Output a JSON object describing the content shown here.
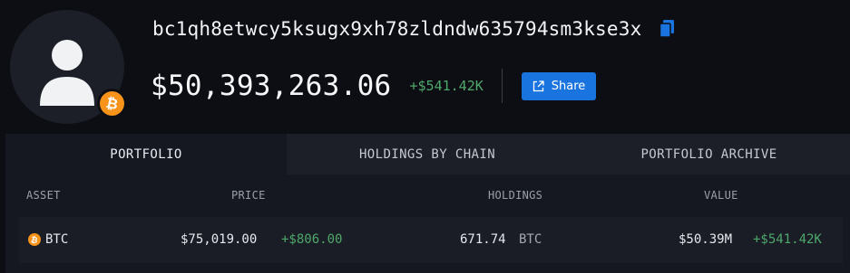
{
  "wallet": {
    "address": "bc1qh8etwcy5ksugx9xh78zldndw635794sm3kse3x",
    "balance": "$50,393,263.06",
    "balance_change": "+$541.42K",
    "share_label": "Share"
  },
  "tabs": [
    {
      "label": "PORTFOLIO",
      "active": true
    },
    {
      "label": "HOLDINGS BY CHAIN",
      "active": false
    },
    {
      "label": "PORTFOLIO ARCHIVE",
      "active": false
    }
  ],
  "table": {
    "headers": {
      "asset": "ASSET",
      "price": "PRICE",
      "holdings": "HOLDINGS",
      "value": "VALUE"
    },
    "rows": [
      {
        "asset": "BTC",
        "price": "$75,019.00",
        "price_change": "+$806.00",
        "holdings": "671.74",
        "holdings_unit": "BTC",
        "value": "$50.39M",
        "value_change": "+$541.42K"
      }
    ]
  },
  "colors": {
    "accent": "#1a74e0",
    "positive": "#4fa86b",
    "bitcoin": "#f7931a"
  },
  "icons": {
    "avatar": "user-icon",
    "badge": "bitcoin-icon",
    "copy": "copy-icon",
    "share": "external-link-icon"
  }
}
